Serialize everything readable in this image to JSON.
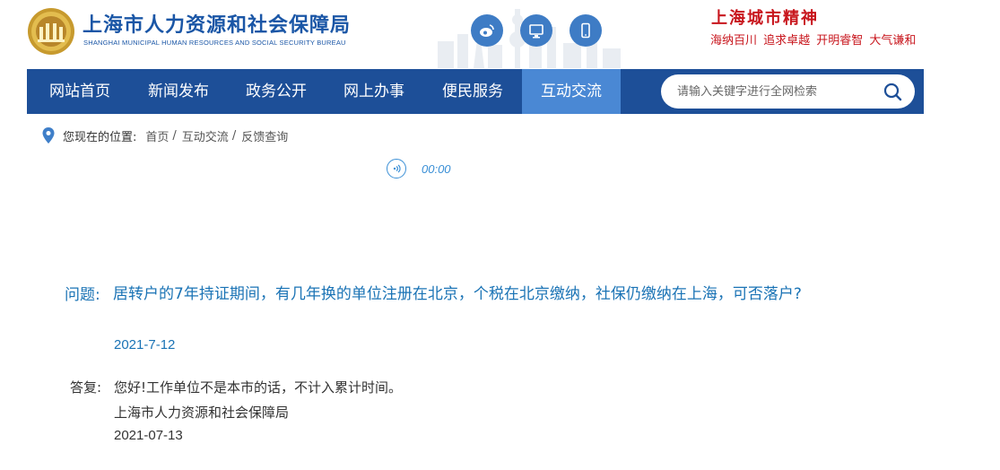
{
  "header": {
    "org_name_cn": "上海市人力资源和社会保障局",
    "org_name_en": "SHANGHAI MUNICIPAL HUMAN RESOURCES AND SOCIAL SECURITY BUREAU",
    "spirit_title": "上海城市精神",
    "spirit_slogan": "海纳百川 追求卓越 开明睿智 大气谦和",
    "icons": [
      "weibo-icon",
      "desktop-icon",
      "mobile-icon"
    ]
  },
  "nav": {
    "items": [
      {
        "label": "网站首页"
      },
      {
        "label": "新闻发布"
      },
      {
        "label": "政务公开"
      },
      {
        "label": "网上办事"
      },
      {
        "label": "便民服务"
      },
      {
        "label": "互动交流"
      }
    ],
    "active_index": 5,
    "search_placeholder": "请输入关键字进行全网检索"
  },
  "breadcrumb": {
    "label": "您现在的位置:",
    "items": [
      "首页",
      "互动交流",
      "反馈查询"
    ],
    "separator": "/"
  },
  "audio": {
    "time": "00:00"
  },
  "qa": {
    "question_label": "问题:",
    "question_text": "居转户的7年持证期间，有几年换的单位注册在北京，个税在北京缴纳，社保仍缴纳在上海，可否落户?",
    "question_date": "2021-7-12",
    "answer_label": "答复:",
    "answer_text": "您好!工作单位不是本市的话，不计入累计时间。",
    "answer_org": "上海市人力资源和社会保障局",
    "answer_date": "2021-07-13"
  },
  "colors": {
    "nav_bg": "#1d4f98",
    "nav_active": "#4a88d4",
    "brand_blue": "#1a56a6",
    "spirit_red": "#c8161d",
    "question_blue": "#1a73b5"
  }
}
